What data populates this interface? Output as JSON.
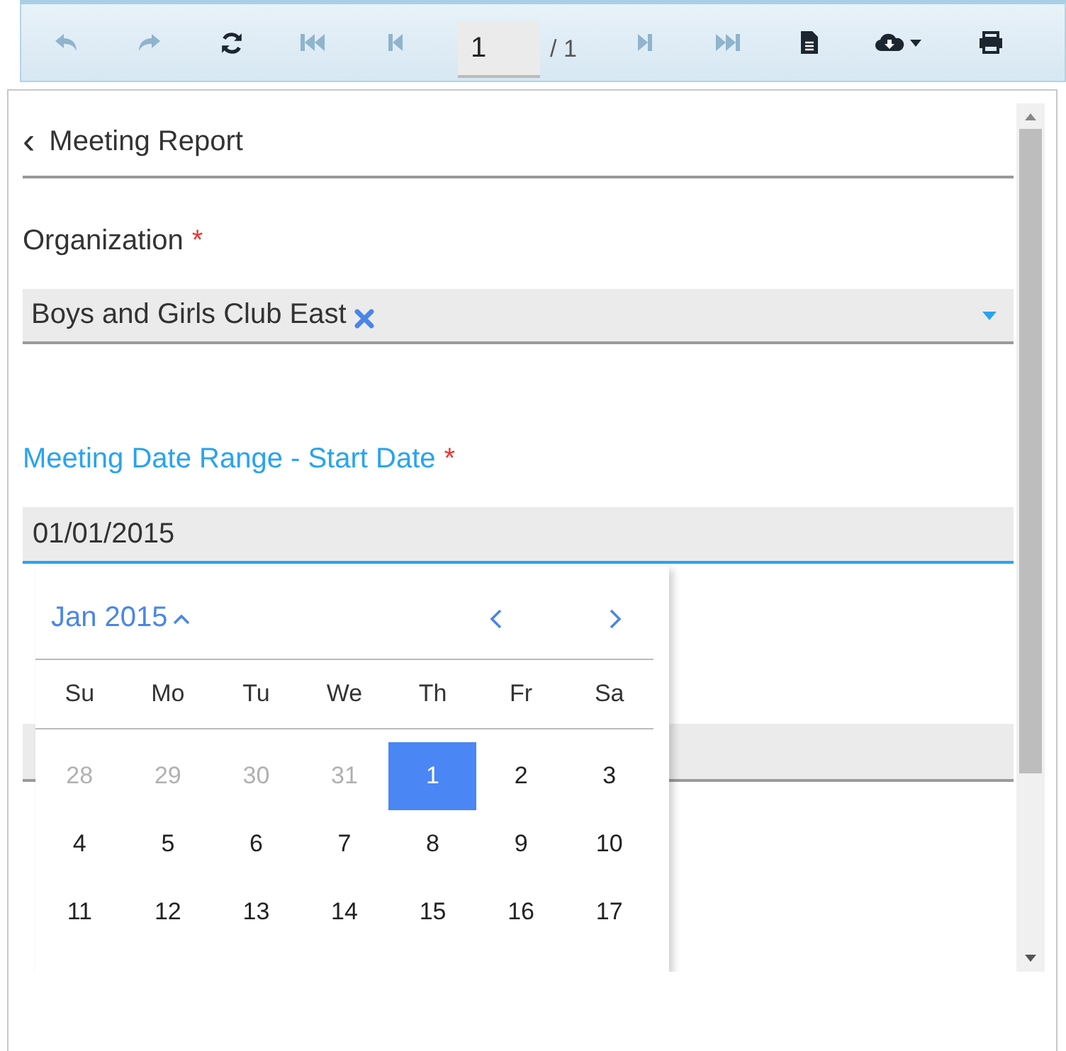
{
  "toolbar": {
    "buttons_before": [
      {
        "kind": "undo",
        "disabled": true
      },
      {
        "kind": "redo",
        "disabled": true
      },
      {
        "kind": "refresh",
        "disabled": false
      },
      {
        "kind": "first",
        "disabled": true
      },
      {
        "kind": "prev",
        "disabled": true
      }
    ],
    "page_field": {
      "value": "1"
    },
    "page_total": "/ 1",
    "buttons_after": [
      {
        "kind": "next",
        "disabled": true
      },
      {
        "kind": "last",
        "disabled": true
      },
      {
        "kind": "document",
        "disabled": false
      },
      {
        "kind": "cloud",
        "disabled": false
      },
      {
        "kind": "print",
        "disabled": false
      }
    ]
  },
  "panel": {
    "back_icon": "‹",
    "title": "Meeting Report",
    "organization": {
      "label": "Organization",
      "required": "*",
      "chip": "Boys and Girls Club East"
    },
    "start_date": {
      "label": "Meeting Date Range - Start Date",
      "required": "*",
      "value": "01/01/2015",
      "focused": true
    }
  },
  "calendar": {
    "month": "Jan 2015",
    "weekdays": [
      "Su",
      "Mo",
      "Tu",
      "We",
      "Th",
      "Fr",
      "Sa"
    ],
    "weeks": [
      [
        {
          "day": "28",
          "muted": true,
          "selected": false
        },
        {
          "day": "29",
          "muted": true,
          "selected": false
        },
        {
          "day": "30",
          "muted": true,
          "selected": false
        },
        {
          "day": "31",
          "muted": true,
          "selected": false
        },
        {
          "day": "1",
          "muted": false,
          "selected": true
        },
        {
          "day": "2",
          "muted": false,
          "selected": false
        },
        {
          "day": "3",
          "muted": false,
          "selected": false
        }
      ],
      [
        {
          "day": "4",
          "muted": false,
          "selected": false
        },
        {
          "day": "5",
          "muted": false,
          "selected": false
        },
        {
          "day": "6",
          "muted": false,
          "selected": false
        },
        {
          "day": "7",
          "muted": false,
          "selected": false
        },
        {
          "day": "8",
          "muted": false,
          "selected": false
        },
        {
          "day": "9",
          "muted": false,
          "selected": false
        },
        {
          "day": "10",
          "muted": false,
          "selected": false
        }
      ],
      [
        {
          "day": "11",
          "muted": false,
          "selected": false
        },
        {
          "day": "12",
          "muted": false,
          "selected": false
        },
        {
          "day": "13",
          "muted": false,
          "selected": false
        },
        {
          "day": "14",
          "muted": false,
          "selected": false
        },
        {
          "day": "15",
          "muted": false,
          "selected": false
        },
        {
          "day": "16",
          "muted": false,
          "selected": false
        },
        {
          "day": "17",
          "muted": false,
          "selected": false
        }
      ]
    ]
  }
}
